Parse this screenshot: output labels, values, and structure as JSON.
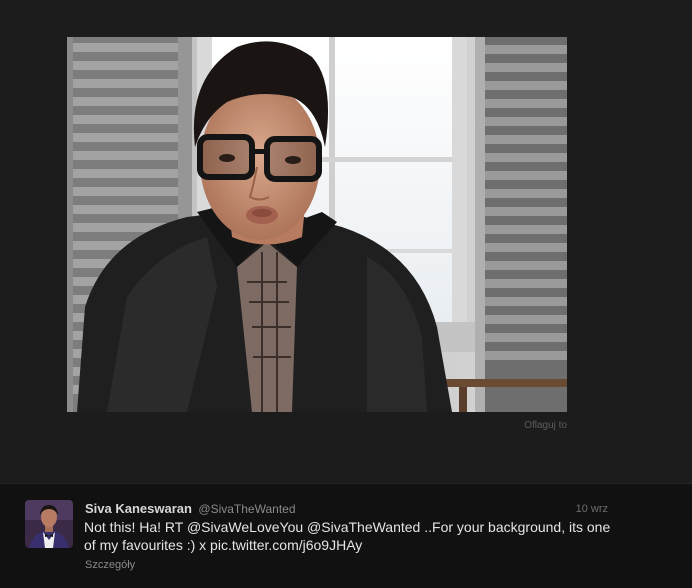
{
  "viewer": {
    "flag_label": "Oflaguj to"
  },
  "tweet": {
    "author_name": "Siva Kaneswaran",
    "author_handle": "@SivaTheWanted",
    "timestamp": "10 wrz",
    "text": {
      "p1": "Not this! Ha! RT ",
      "mention1": "@SivaWeLoveYou",
      "p2": " ",
      "mention2": "@SivaTheWanted",
      "p3": " ..For your background, its one of my favourites :) x ",
      "pic_link": "pic.twitter.com/j6o9JHAy"
    },
    "details_label": "Szczegóły"
  },
  "colors": {
    "background": "#1b1b1b",
    "panel": "#111111",
    "text": "#e4e4e4",
    "muted": "#8a8a8a"
  }
}
